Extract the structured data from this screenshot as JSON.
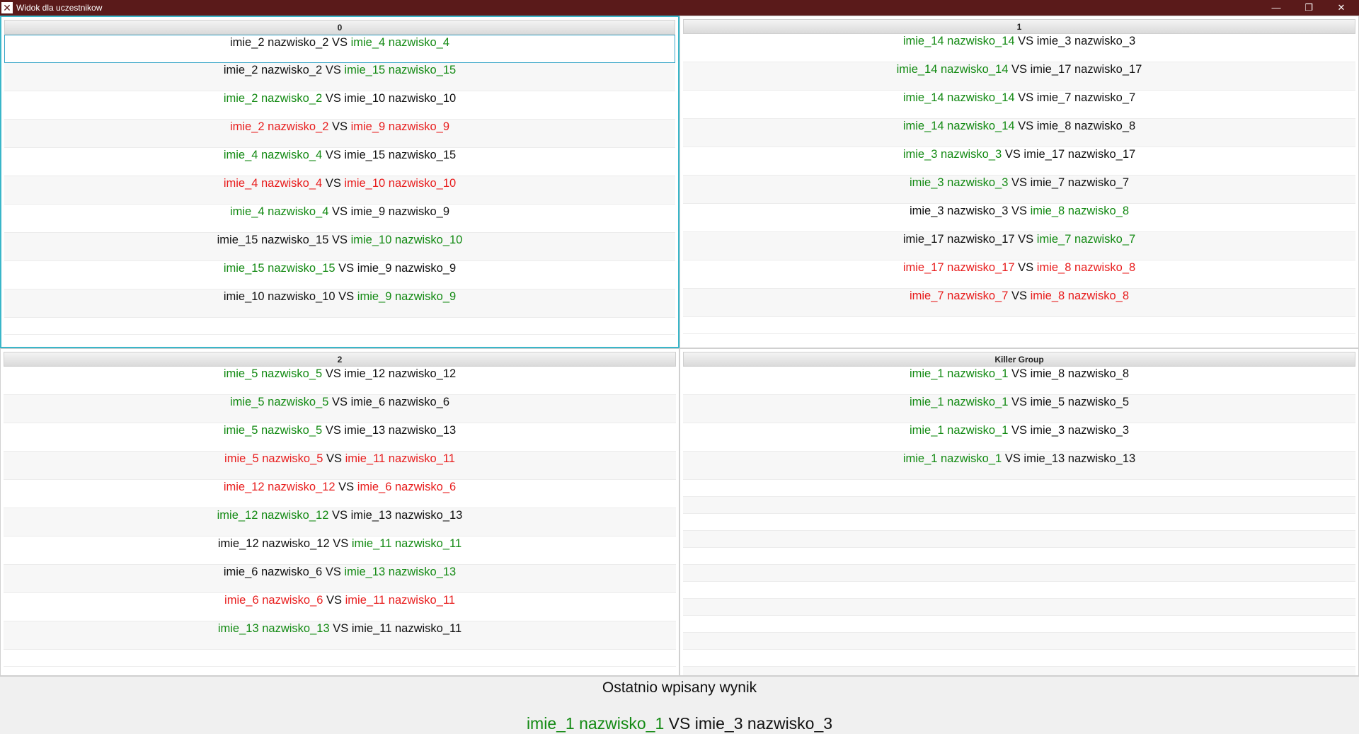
{
  "window": {
    "title": "Widok dla uczestnikow",
    "minimize": "—",
    "restore": "❐",
    "close": "✕"
  },
  "colors": {
    "win": "#138a13",
    "loss": "#e81d1d",
    "neutral": "#111111",
    "selection": "#39b6c9"
  },
  "groups": [
    {
      "name": "0",
      "matches": [
        {
          "a": "imie_2 nazwisko_2",
          "b": "imie_4 nazwisko_4",
          "a_state": "neutral",
          "b_state": "win"
        },
        {
          "a": "imie_2 nazwisko_2",
          "b": "imie_15 nazwisko_15",
          "a_state": "neutral",
          "b_state": "win"
        },
        {
          "a": "imie_2 nazwisko_2",
          "b": "imie_10 nazwisko_10",
          "a_state": "win",
          "b_state": "neutral"
        },
        {
          "a": "imie_2 nazwisko_2",
          "b": "imie_9 nazwisko_9",
          "a_state": "loss",
          "b_state": "loss"
        },
        {
          "a": "imie_4 nazwisko_4",
          "b": "imie_15 nazwisko_15",
          "a_state": "win",
          "b_state": "neutral"
        },
        {
          "a": "imie_4 nazwisko_4",
          "b": "imie_10 nazwisko_10",
          "a_state": "loss",
          "b_state": "loss"
        },
        {
          "a": "imie_4 nazwisko_4",
          "b": "imie_9 nazwisko_9",
          "a_state": "win",
          "b_state": "neutral"
        },
        {
          "a": "imie_15 nazwisko_15",
          "b": "imie_10 nazwisko_10",
          "a_state": "neutral",
          "b_state": "win"
        },
        {
          "a": "imie_15 nazwisko_15",
          "b": "imie_9 nazwisko_9",
          "a_state": "win",
          "b_state": "neutral"
        },
        {
          "a": "imie_10 nazwisko_10",
          "b": "imie_9 nazwisko_9",
          "a_state": "neutral",
          "b_state": "win"
        }
      ]
    },
    {
      "name": "1",
      "matches": [
        {
          "a": "imie_14 nazwisko_14",
          "b": "imie_3 nazwisko_3",
          "a_state": "win",
          "b_state": "neutral"
        },
        {
          "a": "imie_14 nazwisko_14",
          "b": "imie_17 nazwisko_17",
          "a_state": "win",
          "b_state": "neutral"
        },
        {
          "a": "imie_14 nazwisko_14",
          "b": "imie_7 nazwisko_7",
          "a_state": "win",
          "b_state": "neutral"
        },
        {
          "a": "imie_14 nazwisko_14",
          "b": "imie_8 nazwisko_8",
          "a_state": "win",
          "b_state": "neutral"
        },
        {
          "a": "imie_3 nazwisko_3",
          "b": "imie_17 nazwisko_17",
          "a_state": "win",
          "b_state": "neutral"
        },
        {
          "a": "imie_3 nazwisko_3",
          "b": "imie_7 nazwisko_7",
          "a_state": "win",
          "b_state": "neutral"
        },
        {
          "a": "imie_3 nazwisko_3",
          "b": "imie_8 nazwisko_8",
          "a_state": "neutral",
          "b_state": "win"
        },
        {
          "a": "imie_17 nazwisko_17",
          "b": "imie_7 nazwisko_7",
          "a_state": "neutral",
          "b_state": "win"
        },
        {
          "a": "imie_17 nazwisko_17",
          "b": "imie_8 nazwisko_8",
          "a_state": "loss",
          "b_state": "loss"
        },
        {
          "a": "imie_7 nazwisko_7",
          "b": "imie_8 nazwisko_8",
          "a_state": "loss",
          "b_state": "loss"
        }
      ]
    },
    {
      "name": "2",
      "matches": [
        {
          "a": "imie_5 nazwisko_5",
          "b": "imie_12 nazwisko_12",
          "a_state": "win",
          "b_state": "neutral"
        },
        {
          "a": "imie_5 nazwisko_5",
          "b": "imie_6 nazwisko_6",
          "a_state": "win",
          "b_state": "neutral"
        },
        {
          "a": "imie_5 nazwisko_5",
          "b": "imie_13 nazwisko_13",
          "a_state": "win",
          "b_state": "neutral"
        },
        {
          "a": "imie_5 nazwisko_5",
          "b": "imie_11 nazwisko_11",
          "a_state": "loss",
          "b_state": "loss"
        },
        {
          "a": "imie_12 nazwisko_12",
          "b": "imie_6 nazwisko_6",
          "a_state": "loss",
          "b_state": "loss"
        },
        {
          "a": "imie_12 nazwisko_12",
          "b": "imie_13 nazwisko_13",
          "a_state": "win",
          "b_state": "neutral"
        },
        {
          "a": "imie_12 nazwisko_12",
          "b": "imie_11 nazwisko_11",
          "a_state": "neutral",
          "b_state": "win"
        },
        {
          "a": "imie_6 nazwisko_6",
          "b": "imie_13 nazwisko_13",
          "a_state": "neutral",
          "b_state": "win"
        },
        {
          "a": "imie_6 nazwisko_6",
          "b": "imie_11 nazwisko_11",
          "a_state": "loss",
          "b_state": "loss"
        },
        {
          "a": "imie_13 nazwisko_13",
          "b": "imie_11 nazwisko_11",
          "a_state": "win",
          "b_state": "neutral"
        }
      ]
    },
    {
      "name": "Killer Group",
      "matches": [
        {
          "a": "imie_1 nazwisko_1",
          "b": "imie_8 nazwisko_8",
          "a_state": "win",
          "b_state": "neutral"
        },
        {
          "a": "imie_1 nazwisko_1",
          "b": "imie_5 nazwisko_5",
          "a_state": "win",
          "b_state": "neutral"
        },
        {
          "a": "imie_1 nazwisko_1",
          "b": "imie_3 nazwisko_3",
          "a_state": "win",
          "b_state": "neutral"
        },
        {
          "a": "imie_1 nazwisko_1",
          "b": "imie_13 nazwisko_13",
          "a_state": "win",
          "b_state": "neutral"
        }
      ]
    }
  ],
  "vs_text": "VS",
  "footer": {
    "label": "Ostatnio wpisany wynik",
    "last": {
      "a": "imie_1 nazwisko_1",
      "b": "imie_3 nazwisko_3",
      "a_state": "win",
      "b_state": "neutral"
    }
  }
}
